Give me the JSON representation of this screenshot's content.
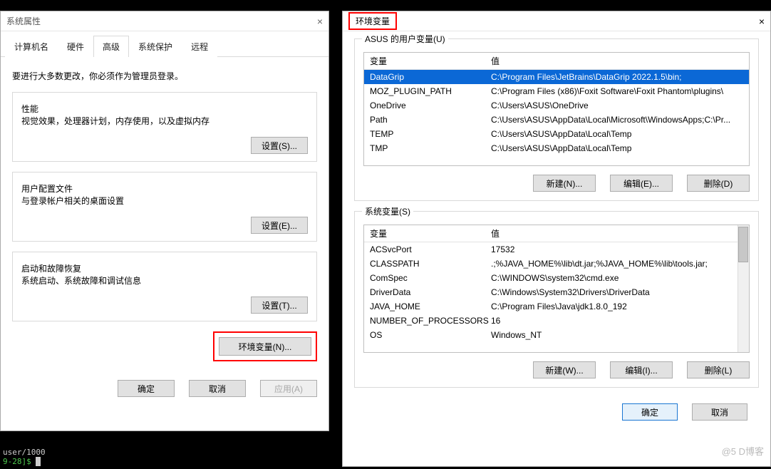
{
  "left": {
    "title": "系统属性",
    "intro": "要进行大多数更改，你必须作为管理员登录。",
    "tabs": [
      "计算机名",
      "硬件",
      "高级",
      "系统保护",
      "远程"
    ],
    "active_tab_index": 2,
    "performance": {
      "legend": "性能",
      "desc": "视觉效果，处理器计划，内存使用，以及虚拟内存",
      "button": "设置(S)..."
    },
    "profile": {
      "legend": "用户配置文件",
      "desc": "与登录帐户相关的桌面设置",
      "button": "设置(E)..."
    },
    "startup": {
      "legend": "启动和故障恢复",
      "desc": "系统启动、系统故障和调试信息",
      "button": "设置(T)..."
    },
    "env_button": "环境变量(N)...",
    "ok": "确定",
    "cancel": "取消",
    "apply": "应用(A)"
  },
  "right": {
    "title": "环境变量",
    "user_section_legend": "ASUS 的用户变量(U)",
    "sys_section_legend": "系统变量(S)",
    "col_var": "变量",
    "col_val": "值",
    "user_vars": [
      {
        "name": "DataGrip",
        "value": "C:\\Program Files\\JetBrains\\DataGrip 2022.1.5\\bin;"
      },
      {
        "name": "MOZ_PLUGIN_PATH",
        "value": "C:\\Program Files (x86)\\Foxit Software\\Foxit Phantom\\plugins\\"
      },
      {
        "name": "OneDrive",
        "value": "C:\\Users\\ASUS\\OneDrive"
      },
      {
        "name": "Path",
        "value": "C:\\Users\\ASUS\\AppData\\Local\\Microsoft\\WindowsApps;C:\\Pr..."
      },
      {
        "name": "TEMP",
        "value": "C:\\Users\\ASUS\\AppData\\Local\\Temp"
      },
      {
        "name": "TMP",
        "value": "C:\\Users\\ASUS\\AppData\\Local\\Temp"
      }
    ],
    "user_selected_index": 0,
    "sys_vars": [
      {
        "name": "ACSvcPort",
        "value": "17532"
      },
      {
        "name": "CLASSPATH",
        "value": ".;%JAVA_HOME%\\lib\\dt.jar;%JAVA_HOME%\\lib\\tools.jar;"
      },
      {
        "name": "ComSpec",
        "value": "C:\\WINDOWS\\system32\\cmd.exe"
      },
      {
        "name": "DriverData",
        "value": "C:\\Windows\\System32\\Drivers\\DriverData"
      },
      {
        "name": "JAVA_HOME",
        "value": "C:\\Program Files\\Java\\jdk1.8.0_192"
      },
      {
        "name": "NUMBER_OF_PROCESSORS",
        "value": "16"
      },
      {
        "name": "OS",
        "value": "Windows_NT"
      }
    ],
    "btn_new_n": "新建(N)...",
    "btn_edit_e": "编辑(E)...",
    "btn_del_d": "删除(D)",
    "btn_new_w": "新建(W)...",
    "btn_edit_i": "编辑(I)...",
    "btn_del_l": "删除(L)",
    "ok": "确定",
    "cancel": "取消"
  },
  "terminal": {
    "line1": "user/1000",
    "prompt": "9-28]$"
  },
  "watermark": "@5   D博客"
}
